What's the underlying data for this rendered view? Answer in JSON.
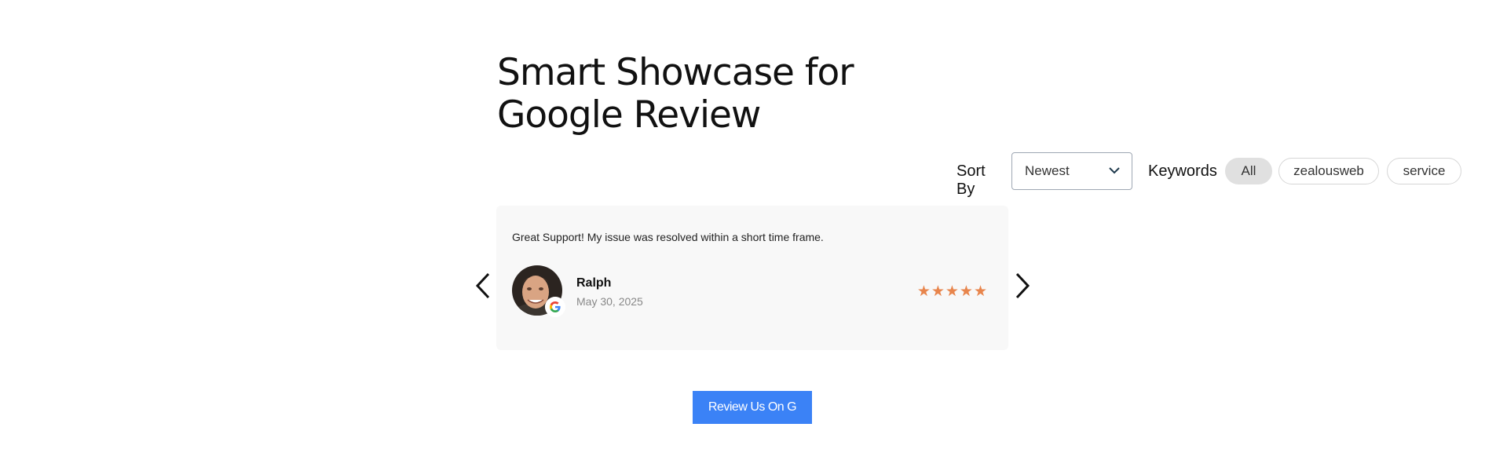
{
  "page": {
    "title_line1": "Smart Showcase for",
    "title_line2": "Google Review"
  },
  "filters": {
    "sort_label": "Sort By",
    "sort_value": "Newest",
    "keywords_label": "Keywords",
    "keywords": [
      {
        "label": "All",
        "active": true
      },
      {
        "label": "zealousweb",
        "active": false
      },
      {
        "label": "service",
        "active": false
      }
    ]
  },
  "review": {
    "text": "Great Support! My issue was resolved within a short time frame.",
    "author": "Ralph",
    "date": "May 30, 2025",
    "stars_display": "★★★★★",
    "rating": 5,
    "source_icon": "google-icon"
  },
  "carousel": {
    "prev_icon": "chevron-left-icon",
    "next_icon": "chevron-right-icon"
  },
  "cta": {
    "label": "Review Us On G"
  },
  "colors": {
    "cta_background": "#3b82f6",
    "star": "#e8854c",
    "card_background": "#f8f8f8",
    "active_pill": "#e0e0e0"
  }
}
